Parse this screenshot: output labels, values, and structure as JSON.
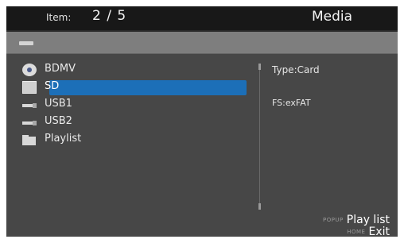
{
  "header": {
    "item_label": "Item:",
    "item_count": "2 / 5",
    "title": "Media"
  },
  "list": {
    "items": [
      {
        "label": "BDMV",
        "icon": "disc-icon"
      },
      {
        "label": "SD",
        "icon": "sd-card-icon",
        "selected": true
      },
      {
        "label": "USB1",
        "icon": "usb-icon"
      },
      {
        "label": "USB2",
        "icon": "usb-icon"
      },
      {
        "label": "Playlist",
        "icon": "folder-icon"
      }
    ]
  },
  "info": {
    "type": "Type:Card",
    "fs": "FS:exFAT"
  },
  "footer": {
    "popup_key": "POPUP",
    "popup_action": "Play list",
    "home_key": "HOME",
    "home_action": "Exit"
  },
  "colors": {
    "background": "#474747",
    "header": "#181818",
    "selection": "#1c6fb8",
    "crumb_bar": "#7e7e7e"
  }
}
